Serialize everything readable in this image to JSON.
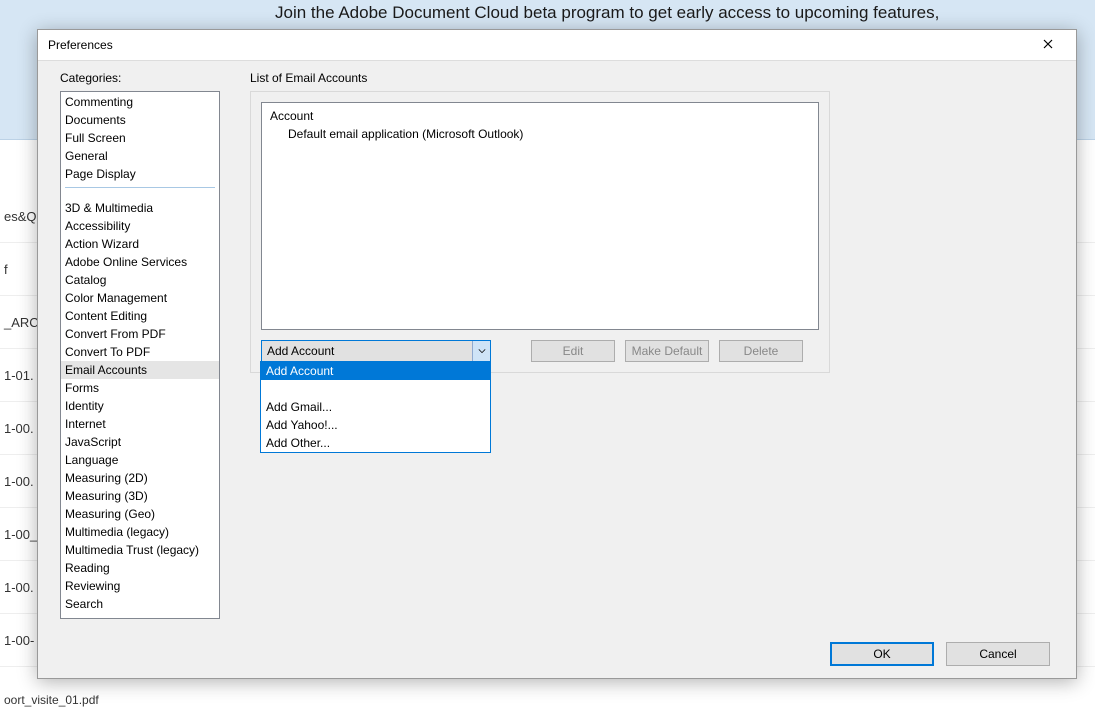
{
  "background": {
    "banner_text": "Join the Adobe Document Cloud beta program to get early access to upcoming features,",
    "rows": [
      "es&Q",
      "f",
      "_ARC",
      "1-01.",
      "1-00.",
      "1-00.",
      "1-00_",
      "1-00.",
      "1-00-"
    ],
    "tail": "oort_visite_01.pdf"
  },
  "dialog": {
    "title": "Preferences",
    "categories_label": "Categories:",
    "categories_top": [
      "Commenting",
      "Documents",
      "Full Screen",
      "General",
      "Page Display"
    ],
    "categories_rest": [
      "3D & Multimedia",
      "Accessibility",
      "Action Wizard",
      "Adobe Online Services",
      "Catalog",
      "Color Management",
      "Content Editing",
      "Convert From PDF",
      "Convert To PDF",
      "Email Accounts",
      "Forms",
      "Identity",
      "Internet",
      "JavaScript",
      "Language",
      "Measuring (2D)",
      "Measuring (3D)",
      "Measuring (Geo)",
      "Multimedia (legacy)",
      "Multimedia Trust (legacy)",
      "Reading",
      "Reviewing",
      "Search"
    ],
    "selected_category": "Email Accounts",
    "group_label": "List of Email Accounts",
    "accounts": {
      "header": "Account",
      "items": [
        "Default email application (Microsoft Outlook)"
      ]
    },
    "combo": {
      "selected": "Add Account",
      "options": [
        "Add Account",
        "",
        "Add Gmail...",
        "Add Yahoo!...",
        "Add Other..."
      ]
    },
    "buttons": {
      "edit": "Edit",
      "make_default": "Make Default",
      "delete": "Delete"
    },
    "footer": {
      "ok": "OK",
      "cancel": "Cancel"
    }
  }
}
